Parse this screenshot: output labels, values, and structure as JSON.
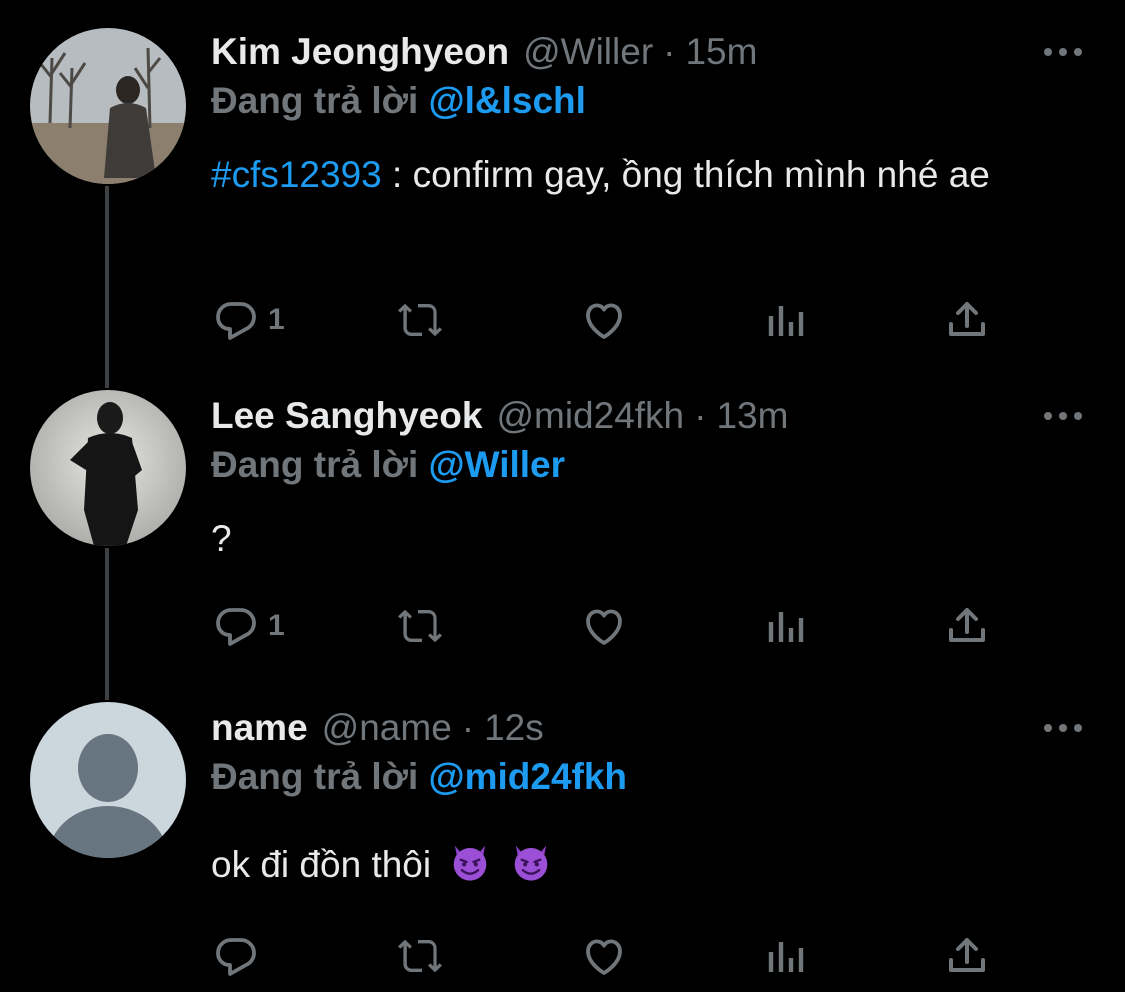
{
  "thread": [
    {
      "display_name": "Kim Jeonghyeon",
      "handle": "@Willer",
      "dot": "·",
      "time": "15m",
      "reply_prefix": "Đang trả lời",
      "reply_handle": "@l&lschl",
      "hashtag": "#cfs12393",
      "text": " : confirm gay, ồng thích mình nhé ae",
      "reply_count": "1",
      "avatar": "photo-man-outdoors-trees"
    },
    {
      "display_name": "Lee Sanghyeok",
      "handle": "@mid24fkh",
      "dot": "·",
      "time": "13m",
      "reply_prefix": "Đang trả lời",
      "reply_handle": "@Willer",
      "text": "?",
      "reply_count": "1",
      "avatar": "photo-man-black-suit"
    },
    {
      "display_name": "name",
      "handle": "@name",
      "dot": "·",
      "time": "12s",
      "reply_prefix": "Đang trả lời",
      "reply_handle": "@mid24fkh",
      "text": "ok đi đồn thôi",
      "emojis": [
        "smiling-imp-emoji",
        "smiling-imp-emoji"
      ],
      "reply_count": "",
      "avatar": "default-profile-placeholder"
    }
  ],
  "icons": {
    "reply": "reply-icon",
    "retweet": "retweet-icon",
    "like": "heart-icon",
    "views": "analytics-icon",
    "share": "share-icon",
    "more": "more-dots-icon"
  },
  "colors": {
    "background": "#000000",
    "text": "#e7e9ea",
    "muted": "#71767b",
    "accent": "#1d9bf0",
    "thread_line": "#3e4144"
  }
}
